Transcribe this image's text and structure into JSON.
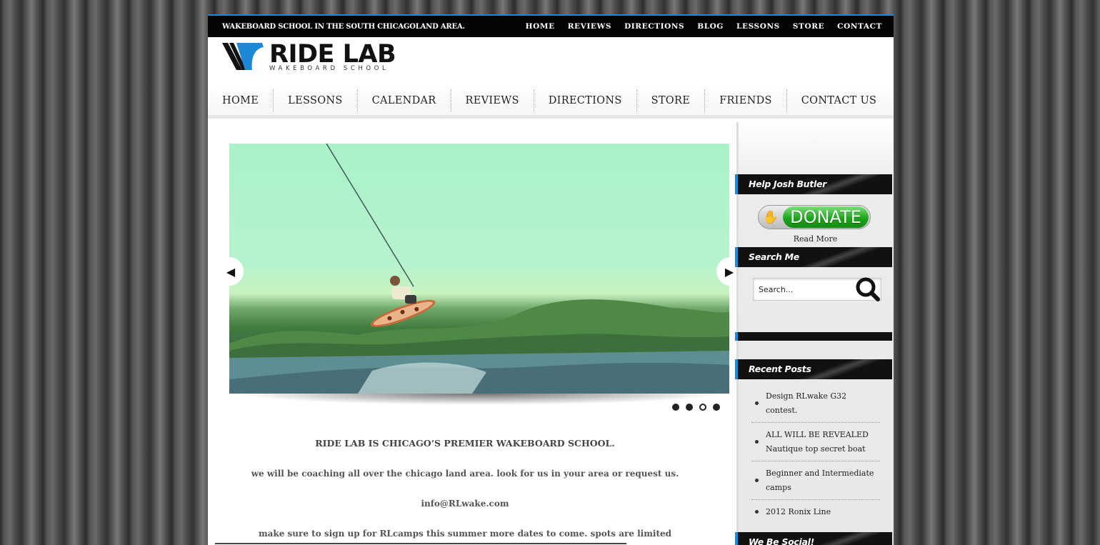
{
  "topbar": {
    "tagline": "WAKEBOARD SCHOOL IN THE SOUTH CHICAGOLAND AREA.",
    "links": [
      "HOME",
      "REVIEWS",
      "DIRECTIONS",
      "BLOG",
      "LESSONS",
      "STORE",
      "CONTACT"
    ]
  },
  "logo": {
    "main": "RIDE LAB",
    "sub": "WAKEBOARD SCHOOL"
  },
  "mainnav": [
    "HOME",
    "LESSONS",
    "CALENDAR",
    "REVIEWS",
    "DIRECTIONS",
    "STORE",
    "FRIENDS",
    "CONTACT US"
  ],
  "slider": {
    "slide_count": 4,
    "active_index": 2
  },
  "intro": {
    "heading": "RIDE LAB IS CHICAGO’S PREMIER WAKEBOARD SCHOOL.",
    "line1": "we will be coaching all over the chicago land area. look for us in your area or request us.",
    "email": "info@RLwake.com",
    "line2": "make sure to sign up for RLcamps this summer more dates to come. spots are limited"
  },
  "sidebar": {
    "donate_title": "Help Josh Butler",
    "donate_label": "DONATE",
    "read_more": "Read More",
    "search_title": "Search Me",
    "search_placeholder": "Search...",
    "recent_title": "Recent Posts",
    "posts": [
      "Design RLwake G32 contest.",
      "ALL WILL BE REVEALED Nautique top secret boat",
      "Beginner and Intermediate camps",
      "2012 Ronix Line"
    ],
    "social_title": "We Be Social!"
  },
  "colors": {
    "accent": "#1e88d8",
    "topbar": "#050505",
    "donate_green": "#1da51d"
  }
}
